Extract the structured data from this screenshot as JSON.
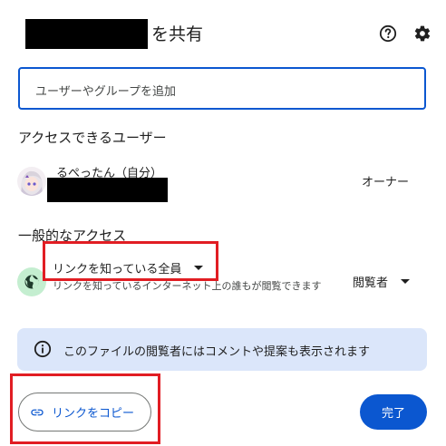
{
  "header": {
    "title": "を共有",
    "help_icon": "help-circle-icon",
    "settings_icon": "gear-icon"
  },
  "add_people": {
    "placeholder": "ユーザーやグループを追加"
  },
  "people_with_access": {
    "title": "アクセスできるユーザー",
    "owner": {
      "name": "るぺったん（自分）",
      "role": "オーナー"
    }
  },
  "general_access": {
    "title": "一般的なアクセス",
    "selected": "リンクを知っている全員",
    "description": "リンクを知っているインターネット上の誰もが閲覧できます",
    "role": "閲覧者"
  },
  "info_banner": {
    "text": "このファイルの閲覧者にはコメントや提案も表示されます"
  },
  "footer": {
    "copy_link": "リンクをコピー",
    "done": "完了"
  },
  "colors": {
    "accent": "#0b57d0",
    "info_bg": "#dbe6fa",
    "highlight": "#e11d23",
    "globe_bg": "#c4eed0"
  }
}
